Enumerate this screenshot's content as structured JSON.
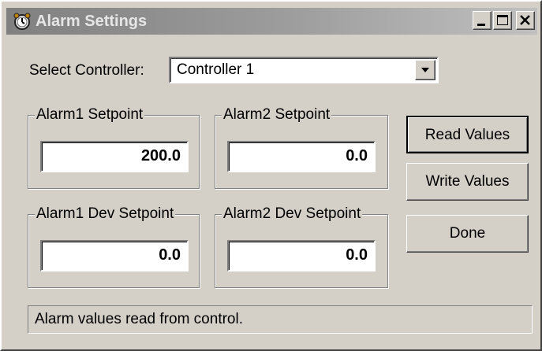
{
  "window": {
    "title": "Alarm Settings",
    "icon": "alarm-clock-icon"
  },
  "controller": {
    "label": "Select Controller:",
    "selected": "Controller 1"
  },
  "groups": [
    {
      "title": "Alarm1 Setpoint",
      "value": "200.0"
    },
    {
      "title": "Alarm2 Setpoint",
      "value": "0.0"
    },
    {
      "title": "Alarm1 Dev Setpoint",
      "value": "0.0"
    },
    {
      "title": "Alarm2 Dev Setpoint",
      "value": "0.0"
    }
  ],
  "buttons": {
    "read": "Read Values",
    "write": "Write Values",
    "done": "Done"
  },
  "status": {
    "message": "Alarm values read from control."
  }
}
